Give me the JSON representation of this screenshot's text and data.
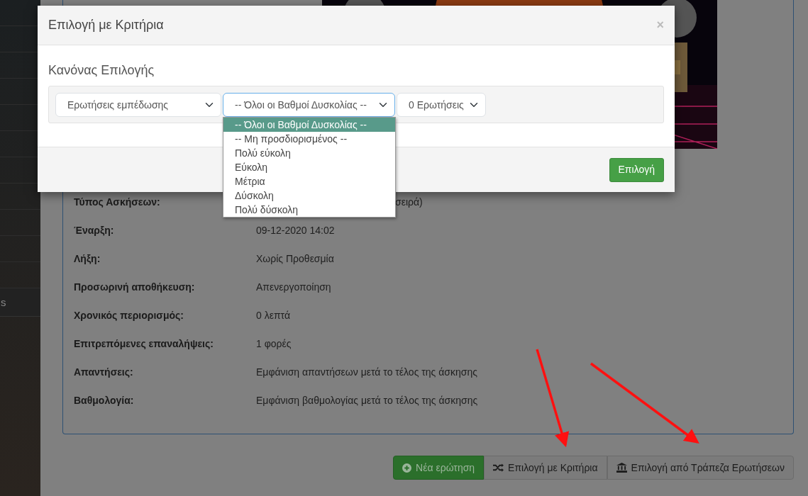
{
  "sidebar": {
    "items": [
      {
        "label": "s"
      }
    ]
  },
  "page": {
    "details": [
      {
        "label": "Τύπος Ασκήσεων:",
        "value": "σειρά)"
      },
      {
        "label": "Έναρξη:",
        "value": "09-12-2020 14:02"
      },
      {
        "label": "Λήξη:",
        "value": "Χωρίς Προθεσμία"
      },
      {
        "label": "Προσωρινή αποθήκευση:",
        "value": "Απενεργοποίηση"
      },
      {
        "label": "Χρονικός περιορισμός:",
        "value": "0 λεπτά"
      },
      {
        "label": "Επιτρεπόμενες επαναλήψεις:",
        "value": "1 φορές"
      },
      {
        "label": "Απαντήσεις:",
        "value": "Εμφάνιση απαντήσεων μετά το τέλος της άσκησης"
      },
      {
        "label": "Βαθμολογία:",
        "value": "Εμφάνιση βαθμολογίας μετά το τέλος της άσκησης"
      }
    ],
    "buttons": [
      {
        "label": "Νέα ερώτηση",
        "kind": "success"
      },
      {
        "label": "Επιλογή με Κριτήρια",
        "kind": "default"
      },
      {
        "label": "Επιλογή από Τράπεζα Ερωτήσεων",
        "kind": "default"
      }
    ]
  },
  "modal": {
    "title": "Επιλογή με Κριτήρια",
    "close": "×",
    "section_title": "Κανόνας Επιλογής",
    "selects": [
      {
        "value": "Ερωτήσεις εμπέδωσης",
        "focused": false
      },
      {
        "value": "-- Όλοι οι Βαθμοί Δυσκολίας --",
        "focused": true
      },
      {
        "value": "0 Ερωτήσεις",
        "focused": false
      }
    ],
    "dropdown": {
      "options": [
        {
          "label": "-- Όλοι οι Βαθμοί Δυσκολίας --",
          "selected": true
        },
        {
          "label": "-- Μη προσδιορισμένος --",
          "selected": false
        },
        {
          "label": "Πολύ εύκολη",
          "selected": false
        },
        {
          "label": "Εύκολη",
          "selected": false
        },
        {
          "label": "Μέτρια",
          "selected": false
        },
        {
          "label": "Δύσκολη",
          "selected": false
        },
        {
          "label": "Πολύ δύσκολη",
          "selected": false
        }
      ]
    },
    "footer_button": {
      "label": "Επιλογή"
    }
  }
}
